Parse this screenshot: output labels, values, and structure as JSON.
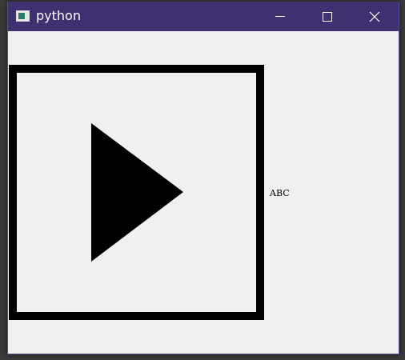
{
  "window": {
    "title": "python",
    "titlebar_color": "#3f3070",
    "background_color": "#f0f0f0"
  },
  "icons": {
    "app": "python-window-icon",
    "minimize": "minimize-icon",
    "maximize": "maximize-icon",
    "close": "close-icon",
    "main": "play-icon"
  },
  "content": {
    "label": "ABC"
  }
}
